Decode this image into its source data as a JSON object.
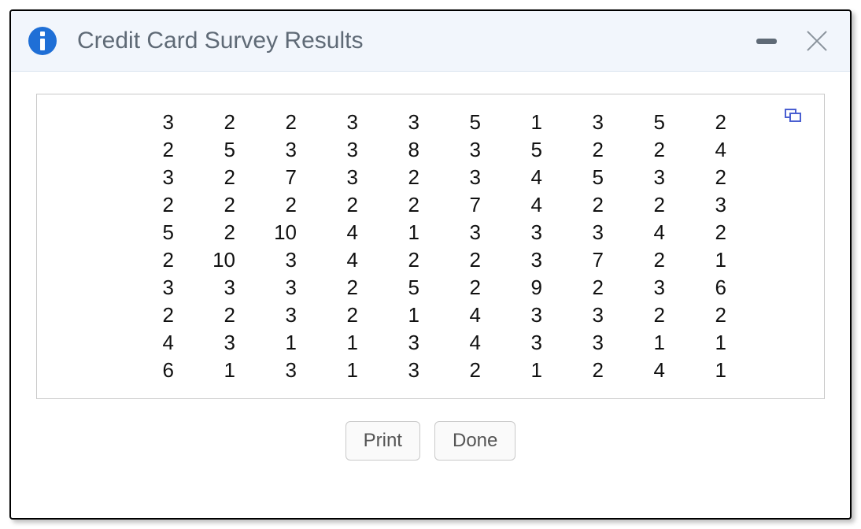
{
  "dialog": {
    "title": "Credit Card Survey Results"
  },
  "buttons": {
    "print": "Print",
    "done": "Done"
  },
  "grid": {
    "rows": [
      [
        3,
        2,
        2,
        3,
        3,
        5,
        1,
        3,
        5,
        2
      ],
      [
        2,
        5,
        3,
        3,
        8,
        3,
        5,
        2,
        2,
        4
      ],
      [
        3,
        2,
        7,
        3,
        2,
        3,
        4,
        5,
        3,
        2
      ],
      [
        2,
        2,
        2,
        2,
        2,
        7,
        4,
        2,
        2,
        3
      ],
      [
        5,
        2,
        10,
        4,
        1,
        3,
        3,
        3,
        4,
        2
      ],
      [
        2,
        10,
        3,
        4,
        2,
        2,
        3,
        7,
        2,
        1
      ],
      [
        3,
        3,
        3,
        2,
        5,
        2,
        9,
        2,
        3,
        6
      ],
      [
        2,
        2,
        3,
        2,
        1,
        4,
        3,
        3,
        2,
        2
      ],
      [
        4,
        3,
        1,
        1,
        3,
        4,
        3,
        3,
        1,
        1
      ],
      [
        6,
        1,
        3,
        1,
        3,
        2,
        1,
        2,
        4,
        1
      ]
    ]
  },
  "colors": {
    "info_icon": "#1f6fd6",
    "titlebar_bg": "#f2f6fc",
    "copy_icon": "#4a5fd1"
  }
}
